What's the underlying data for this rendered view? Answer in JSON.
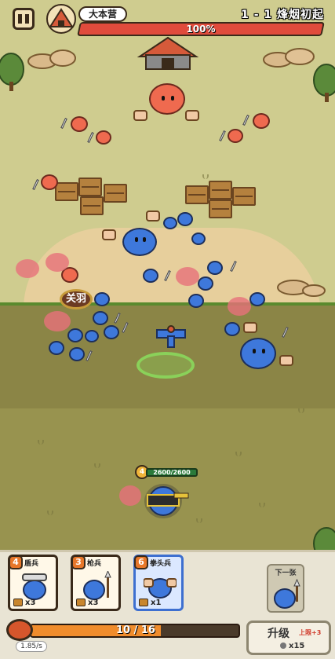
{
  "hud": {
    "base_name": "大本营",
    "stage_label": "1 - 1  烽烟初起",
    "base_health_text": "100%",
    "base_health_fraction": 1.0
  },
  "field": {
    "hero_tag": "关羽",
    "hero_level": "4",
    "hero_hp_text": "2600/2600",
    "hero_hp_fraction": 1.0
  },
  "cards": [
    {
      "cost": "4",
      "name": "盾兵",
      "count": "x3",
      "weapon": "shield-icon"
    },
    {
      "cost": "3",
      "name": "枪兵",
      "count": "x3",
      "weapon": "spear-icon"
    },
    {
      "cost": "6",
      "name": "拳头兵",
      "count": "x1",
      "weapon": "fist-icon",
      "active": true
    }
  ],
  "next_card": {
    "label": "下一张"
  },
  "energy": {
    "text": "10 / 16",
    "current": 10,
    "max": 16,
    "rate": "1.85/s"
  },
  "upgrade": {
    "label": "升级",
    "sub": "上限+3",
    "cost": "x15"
  },
  "colors": {
    "player": "#3e78db",
    "enemy": "#ef6a4f",
    "health_bar": "#e04b3c",
    "energy": "#f08c2c"
  }
}
